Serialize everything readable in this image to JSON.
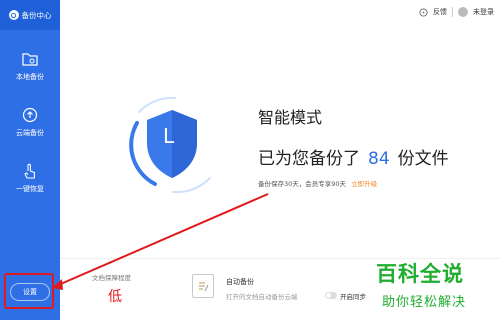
{
  "sidebar": {
    "brand_label": "备份中心",
    "items": [
      {
        "label": "本地备份",
        "icon": "folder-icon"
      },
      {
        "label": "云端备份",
        "icon": "cloud-upload-icon"
      },
      {
        "label": "一键恢复",
        "icon": "touch-hand-icon"
      }
    ],
    "settings_label": "设置"
  },
  "topbar": {
    "feedback_label": "反馈",
    "login_label": "未登录"
  },
  "main": {
    "mode_title": "智能模式",
    "backup_prefix": "已为您备份了",
    "backup_count": "84",
    "backup_suffix": "份文件",
    "retention_text": "备份保存30天，会员专享90天",
    "upgrade_label": "立即升级",
    "shield_letter": "L"
  },
  "bottom": {
    "protect_label": "文档保障程度",
    "protect_level": "低",
    "auto_backup_title": "自动备份",
    "auto_backup_desc": "打开的文档自动备份云端",
    "sync_label": "开启同步"
  },
  "watermark": {
    "line1": "百科全说",
    "line2": "助你轻松解决"
  },
  "colors": {
    "sidebar": "#2f6fe6",
    "accent": "#2f6fe6",
    "warning": "#e0191d",
    "upgrade": "#f28a2e",
    "watermark": "#1fae2f"
  }
}
